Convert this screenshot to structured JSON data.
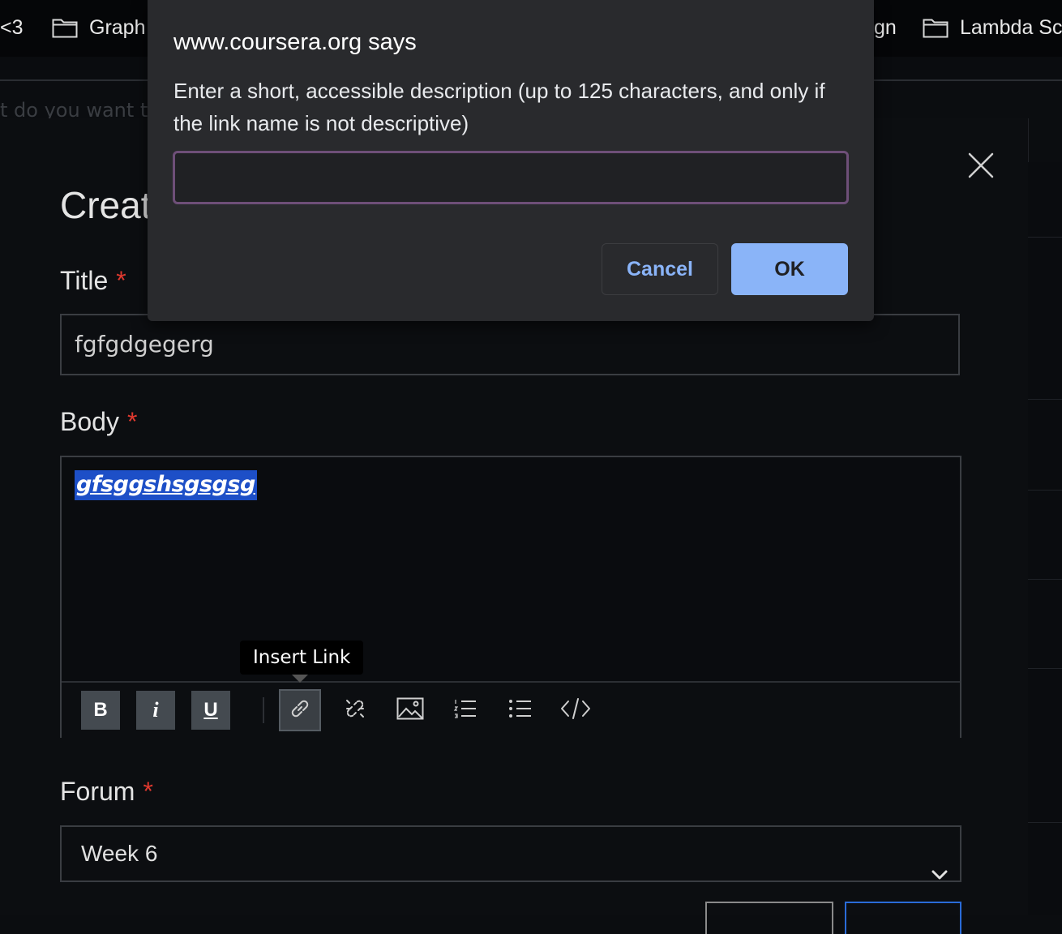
{
  "bookmarks": {
    "items": [
      {
        "label": "<3",
        "has_folder": false
      },
      {
        "label": "Graph",
        "has_folder": true
      },
      {
        "label": "gn",
        "has_folder": false
      },
      {
        "label": "Lambda Sc",
        "has_folder": true
      }
    ]
  },
  "background": {
    "prompt_text": "t do you want to"
  },
  "form": {
    "heading": "Creat",
    "title_label": "Title",
    "title_value": "fgfgdgegerg",
    "body_label": "Body",
    "body_text": "gfsggshsgsgsg",
    "forum_label": "Forum",
    "forum_value": "Week 6",
    "required_mark": "*"
  },
  "toolbar": {
    "bold": "B",
    "italic": "i",
    "underline": "U",
    "tooltip": "Insert Link"
  },
  "dialog": {
    "title": "www.coursera.org says",
    "message": "Enter a short, accessible description (up to 125 characters, and only if the link name is not descriptive)",
    "input_value": "",
    "cancel_label": "Cancel",
    "ok_label": "OK"
  },
  "colors": {
    "required": "#e0392f",
    "selection": "#1d4fc7",
    "ok_button": "#8ab4f8",
    "input_focus": "#6e4f78"
  },
  "icons": [
    "folder-icon",
    "close-icon",
    "link-icon",
    "unlink-icon",
    "image-icon",
    "numbered-list-icon",
    "bulleted-list-icon",
    "code-icon",
    "chevron-down-icon"
  ]
}
